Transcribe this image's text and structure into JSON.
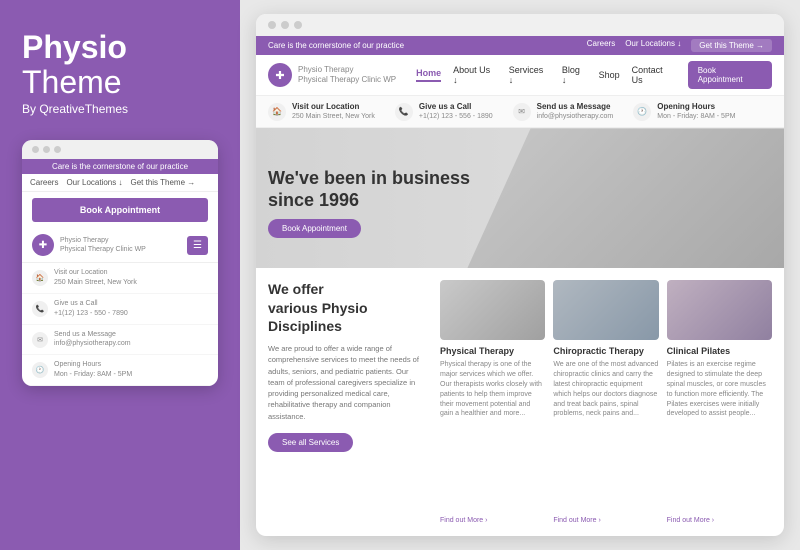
{
  "brand": {
    "name_bold": "Physio",
    "name_regular": "Theme",
    "by_line": "By QreativeThemes"
  },
  "mobile": {
    "notice": "Care is the cornerstone of our practice",
    "nav_links": [
      "Careers",
      "Our Locations ↓",
      "Get this Theme →"
    ],
    "book_btn": "Book Appointment",
    "logo_name": "Physio Therapy",
    "logo_sub": "Physical Therapy Clinic WP",
    "info": [
      {
        "icon": "📍",
        "title": "Visit our Location",
        "sub": "250 Main Street, New York"
      },
      {
        "icon": "📞",
        "title": "Give us a Call",
        "sub": "+1(12) 123 - 550 - 7890"
      },
      {
        "icon": "✉",
        "title": "Send us a Message",
        "sub": "info@physiotherapy.com"
      },
      {
        "icon": "🕐",
        "title": "Opening Hours",
        "sub": "Mon - Friday: 8AM - 5PM"
      }
    ]
  },
  "desktop": {
    "notice": "Care is the cornerstone of our practice",
    "notice_links": [
      "Careers",
      "Our Locations ↓",
      "Get this Theme →"
    ],
    "logo_name": "Physio Therapy",
    "logo_sub": "Physical Therapy Clinic WP",
    "nav_links": [
      "Home",
      "About Us ↓",
      "Services ↓",
      "Blog ↓",
      "Shop",
      "Contact Us"
    ],
    "book_btn": "Book Appointment",
    "info_items": [
      {
        "icon": "📍",
        "title": "Visit our Location",
        "sub": "250 Main Street, New York"
      },
      {
        "icon": "📞",
        "title": "Give us a Call",
        "sub": "+1(12) 123 - 556 - 1890"
      },
      {
        "icon": "✉",
        "title": "Send us a Message",
        "sub": "info@physiotherapy.com"
      },
      {
        "icon": "🕐",
        "title": "Opening Hours",
        "sub": "Mon - Friday: 8AM - 5PM"
      }
    ],
    "hero_heading_line1": "We've been in business",
    "hero_heading_line2": "since 1996",
    "hero_book_btn": "Book Appointment",
    "content_heading_line1": "We offer",
    "content_heading_line2": "various Physio",
    "content_heading_line3": "Disciplines",
    "content_text": "We are proud to offer a wide range of comprehensive services to meet the needs of adults, seniors, and pediatric patients. Our team of professional caregivers specialize in providing personalized medical care, rehabilitative therapy and companion assistance.",
    "see_services_btn": "See all Services",
    "services": [
      {
        "img_class": "img1",
        "title": "Physical Therapy",
        "text": "Physical therapy is one of the major services which we offer. Our therapists works closely with patients to help them improve their movement potential and gain a healthier and more...",
        "link": "Find out More ›"
      },
      {
        "img_class": "img2",
        "title": "Chiropractic Therapy",
        "text": "We are one of the most advanced chiropractic clinics and carry the latest chiropractic equipment which helps our doctors diagnose and treat back pains, spinal problems, neck pains and...",
        "link": "Find out More ›"
      },
      {
        "img_class": "img3",
        "title": "Clinical Pilates",
        "text": "Pilates is an exercise regime designed to stimulate the deep spinal muscles, or core muscles to function more efficiently. The Pilates exercises were initially developed to assist people...",
        "link": "Find out More ›"
      }
    ]
  }
}
